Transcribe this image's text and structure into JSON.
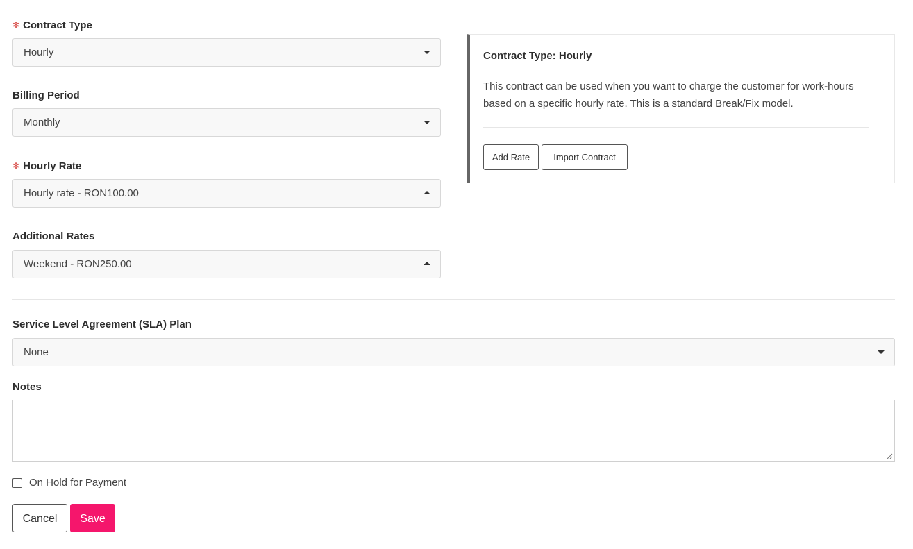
{
  "form": {
    "contract_type": {
      "label": "Contract Type",
      "required_mark": "✻",
      "value": "Hourly"
    },
    "billing_period": {
      "label": "Billing Period",
      "value": "Monthly"
    },
    "hourly_rate": {
      "label": "Hourly Rate",
      "required_mark": "✻",
      "value": "Hourly rate - RON100.00"
    },
    "additional_rates": {
      "label": "Additional Rates",
      "value": "Weekend - RON250.00"
    },
    "sla_plan": {
      "label": "Service Level Agreement (SLA) Plan",
      "value": "None"
    },
    "notes": {
      "label": "Notes",
      "value": ""
    },
    "on_hold": {
      "label": "On Hold for Payment",
      "checked": false
    }
  },
  "info_panel": {
    "title": "Contract Type: Hourly",
    "description": "This contract can be used when you want to charge the customer for work-hours based on a specific hourly rate. This is a standard Break/Fix model.",
    "add_rate_label": "Add Rate",
    "import_contract_label": "Import Contract"
  },
  "actions": {
    "cancel_label": "Cancel",
    "save_label": "Save"
  },
  "colors": {
    "save_button": "#f5166c",
    "required_mark": "#d9534f",
    "panel_accent": "#666666"
  },
  "icons": {
    "select_caret_down": "caret-down-icon",
    "select_caret_up": "caret-up-icon",
    "resize_grip": "resize-grip-icon"
  }
}
